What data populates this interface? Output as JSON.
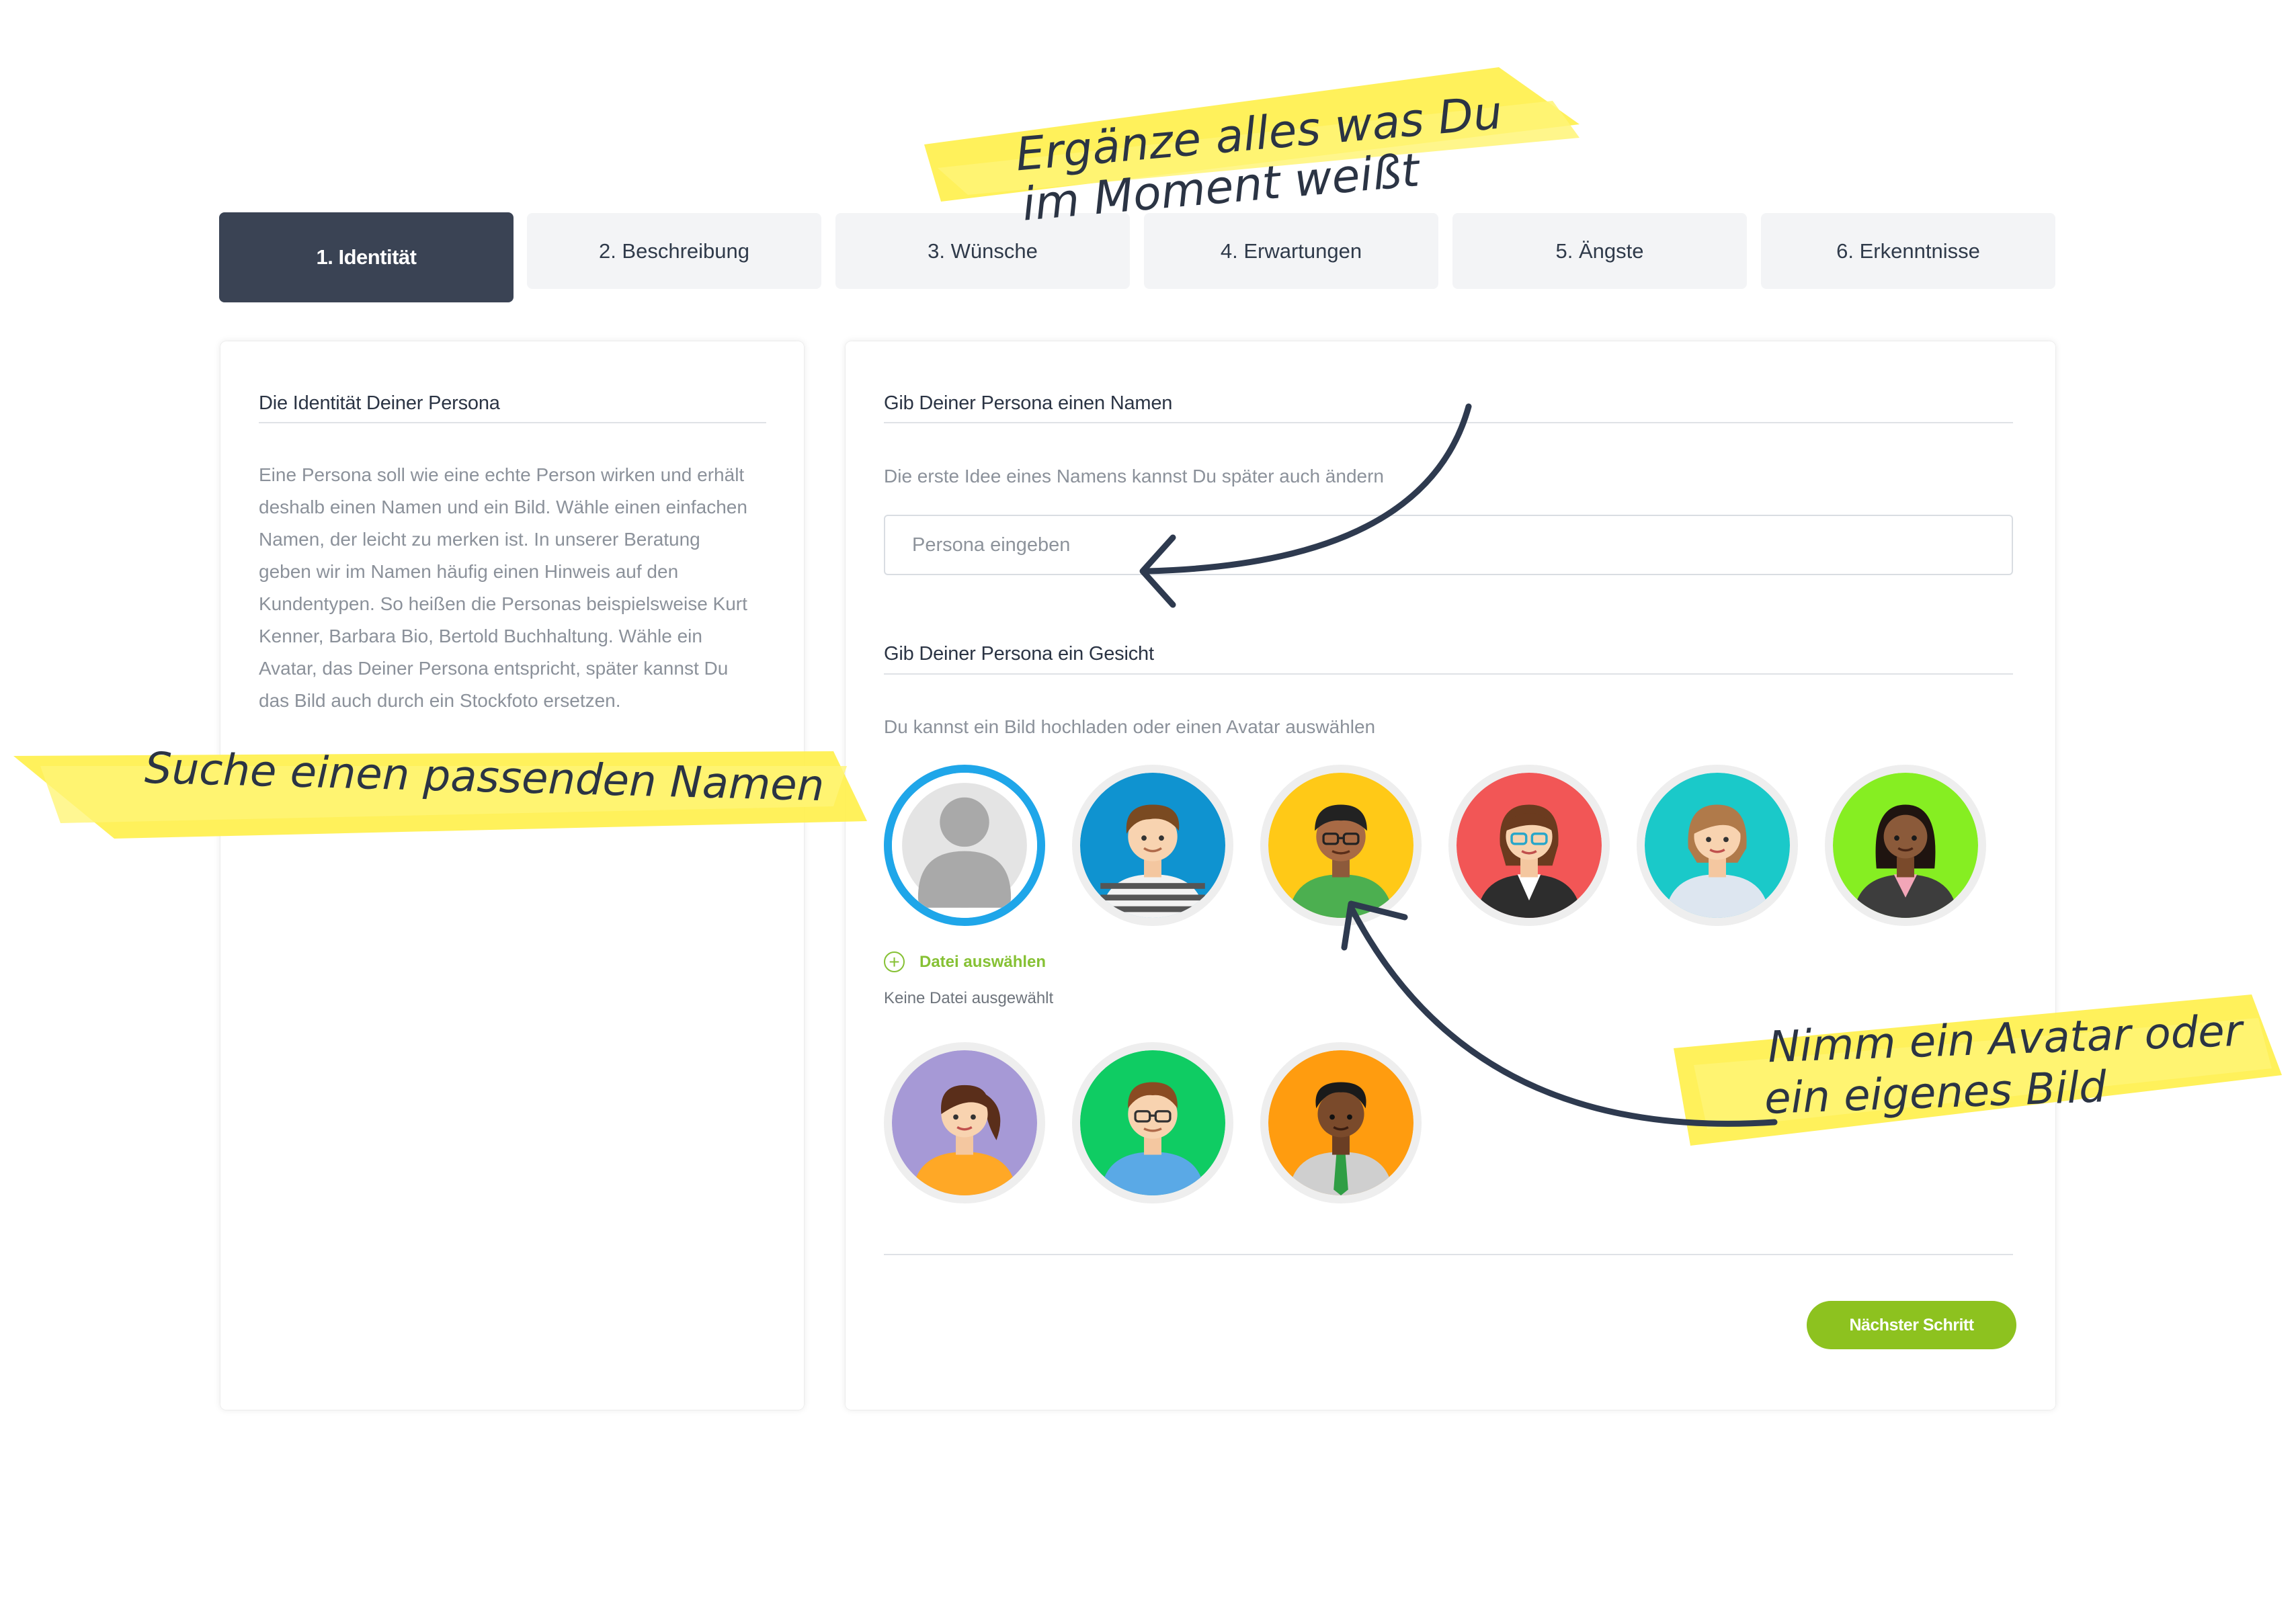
{
  "tabs": [
    {
      "label": "1. Identität",
      "active": true
    },
    {
      "label": "2. Beschreibung",
      "active": false
    },
    {
      "label": "3. Wünsche",
      "active": false
    },
    {
      "label": "4. Erwartungen",
      "active": false
    },
    {
      "label": "5. Ängste",
      "active": false
    },
    {
      "label": "6. Erkenntnisse",
      "active": false
    }
  ],
  "left_panel": {
    "title": "Die Identität Deiner Persona",
    "text": "Eine Persona soll wie eine echte Person wirken und erhält deshalb einen Namen und ein Bild. Wähle einen einfachen Namen, der leicht zu merken ist. In unserer Beratung geben wir im Namen häufig einen Hinweis auf den Kundentypen. So heißen die Personas beispielsweise Kurt Kenner, Barbara Bio, Bertold Buchhaltung. Wähle ein Avatar, das Deiner Persona entspricht, später kannst Du das Bild auch durch ein Stockfoto ersetzen."
  },
  "name_section": {
    "title": "Gib Deiner Persona einen Namen",
    "hint": "Die erste Idee eines Namens kannst Du später auch ändern",
    "input_placeholder": "Persona eingeben",
    "input_value": ""
  },
  "face_section": {
    "title": "Gib Deiner Persona ein Gesicht",
    "hint": "Du kannst ein Bild hochladen oder einen Avatar auswählen",
    "file_button": "Datei auswählen",
    "file_status": "Keine Datei ausgewählt",
    "selected_avatar": 0,
    "avatars": [
      {
        "name": "placeholder-avatar",
        "bg": "#ffffff"
      },
      {
        "name": "avatar-man-striped-shirt",
        "bg": "#0f93d0"
      },
      {
        "name": "avatar-man-glasses-green",
        "bg": "#ffc917"
      },
      {
        "name": "avatar-woman-glasses-blazer",
        "bg": "#f25656"
      },
      {
        "name": "avatar-woman-blonde",
        "bg": "#1ac9c9"
      },
      {
        "name": "avatar-woman-dark-hair",
        "bg": "#86ee22"
      },
      {
        "name": "avatar-woman-ponytail",
        "bg": "#a699d6"
      },
      {
        "name": "avatar-man-glasses-blue",
        "bg": "#0fcc63"
      },
      {
        "name": "avatar-man-tie",
        "bg": "#ff9c0f"
      }
    ]
  },
  "next_button": "Nächster Schritt",
  "annotations": {
    "top_line1": "Ergänze alles was Du",
    "top_line2": "im Moment weißt",
    "left": "Suche einen passenden Namen",
    "right_line1": "Nimm ein Avatar oder",
    "right_line2": "ein eigenes Bild"
  },
  "colors": {
    "active_tab": "#3a4354",
    "selected_ring": "#1fa6e9",
    "accent_green": "#8dc21f",
    "highlighter": "#fff04d"
  }
}
